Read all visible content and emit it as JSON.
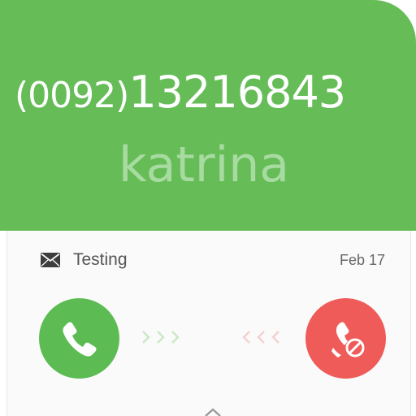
{
  "call": {
    "number_prefix": "(0092)",
    "number_main": "13216843",
    "caller_name": "katrina"
  },
  "message": {
    "icon": "mail-icon",
    "text": "Testing",
    "date": "Feb 17"
  },
  "actions": {
    "accept_icon": "phone-icon",
    "reject_icon": "phone-hangup-icon"
  },
  "colors": {
    "header_green": "#66bd58",
    "accept_green": "#5cbc53",
    "reject_red": "#ee5b59",
    "name_text": "#a8dba1"
  }
}
